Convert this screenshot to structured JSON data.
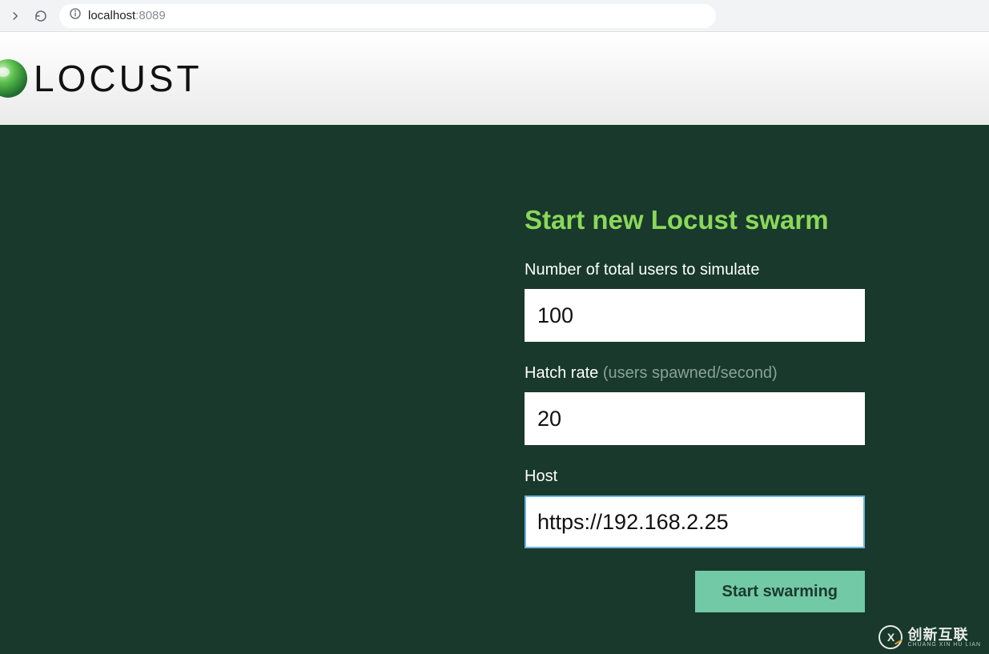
{
  "browser": {
    "url_host": "localhost",
    "url_port": ":8089"
  },
  "header": {
    "logo_text": "LOCUST"
  },
  "form": {
    "title": "Start new Locust swarm",
    "users_label": "Number of total users to simulate",
    "users_value": "100",
    "hatch_label": "Hatch rate ",
    "hatch_hint": "(users spawned/second)",
    "hatch_value": "20",
    "host_label": "Host",
    "host_value": "https://192.168.2.25",
    "submit_label": "Start swarming"
  },
  "watermark": {
    "icon_text": "X",
    "big": "创新互联",
    "small": "CHUANG XIN HU LIAN"
  }
}
